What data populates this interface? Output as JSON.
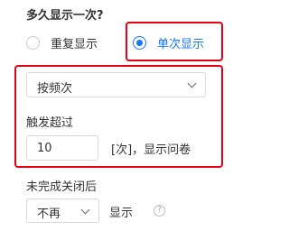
{
  "frequency_section": {
    "title": "多久显示一次?",
    "options": [
      {
        "label": "重复显示",
        "selected": false
      },
      {
        "label": "单次显示",
        "selected": true
      }
    ],
    "selected_option": "单次显示"
  },
  "trigger": {
    "mode_select": {
      "value": "按频次"
    },
    "label": "触发超过",
    "count_input": {
      "value": "10"
    },
    "suffix": "[次]，显示问卷"
  },
  "close_behavior": {
    "label": "未完成关闭后",
    "select": {
      "value": "不再"
    },
    "action_label": "显示",
    "help_icon": "question-circle-icon"
  },
  "colors": {
    "accent": "#1677ff",
    "highlight_border": "#e60012",
    "text": "#333333",
    "border": "#d9d9d9"
  }
}
